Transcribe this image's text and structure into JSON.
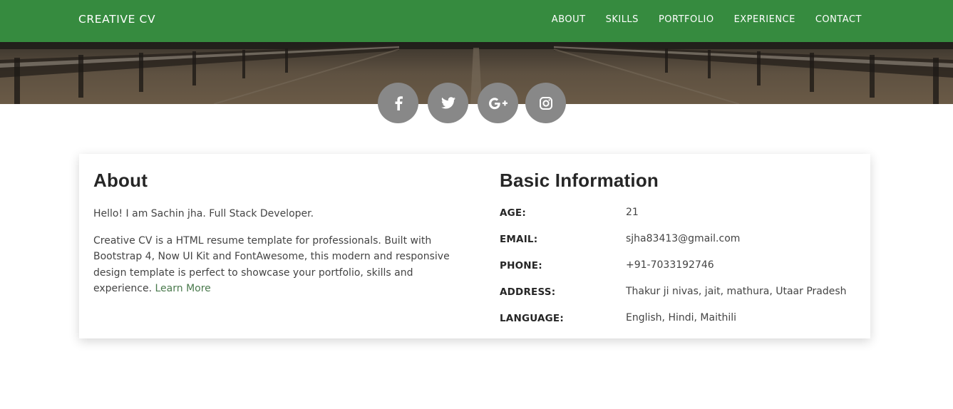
{
  "navbar": {
    "brand": "CREATIVE CV",
    "links": [
      "ABOUT",
      "SKILLS",
      "PORTFOLIO",
      "EXPERIENCE",
      "CONTACT"
    ],
    "color": "#368b3f"
  },
  "social": [
    {
      "name": "facebook",
      "icon": "facebook-icon"
    },
    {
      "name": "twitter",
      "icon": "twitter-icon"
    },
    {
      "name": "google-plus",
      "icon": "google-plus-icon"
    },
    {
      "name": "instagram",
      "icon": "instagram-icon"
    }
  ],
  "about": {
    "title": "About",
    "intro": "Hello! I am Sachin jha. Full Stack Developer.",
    "description": "Creative CV is a HTML resume template for professionals. Built with Bootstrap 4, Now UI Kit and FontAwesome, this modern and responsive design template is perfect to showcase your portfolio, skills and experience.",
    "learn_more": "Learn More"
  },
  "basic_info": {
    "title": "Basic Information",
    "rows": [
      {
        "label": "AGE:",
        "value": "21"
      },
      {
        "label": "EMAIL:",
        "value": "sjha83413@gmail.com"
      },
      {
        "label": "PHONE:",
        "value": "+91-7033192746"
      },
      {
        "label": "ADDRESS:",
        "value": "Thakur ji nivas, jait, mathura, Utaar Pradesh"
      },
      {
        "label": "LANGUAGE:",
        "value": "English, Hindi, Maithili"
      }
    ]
  }
}
